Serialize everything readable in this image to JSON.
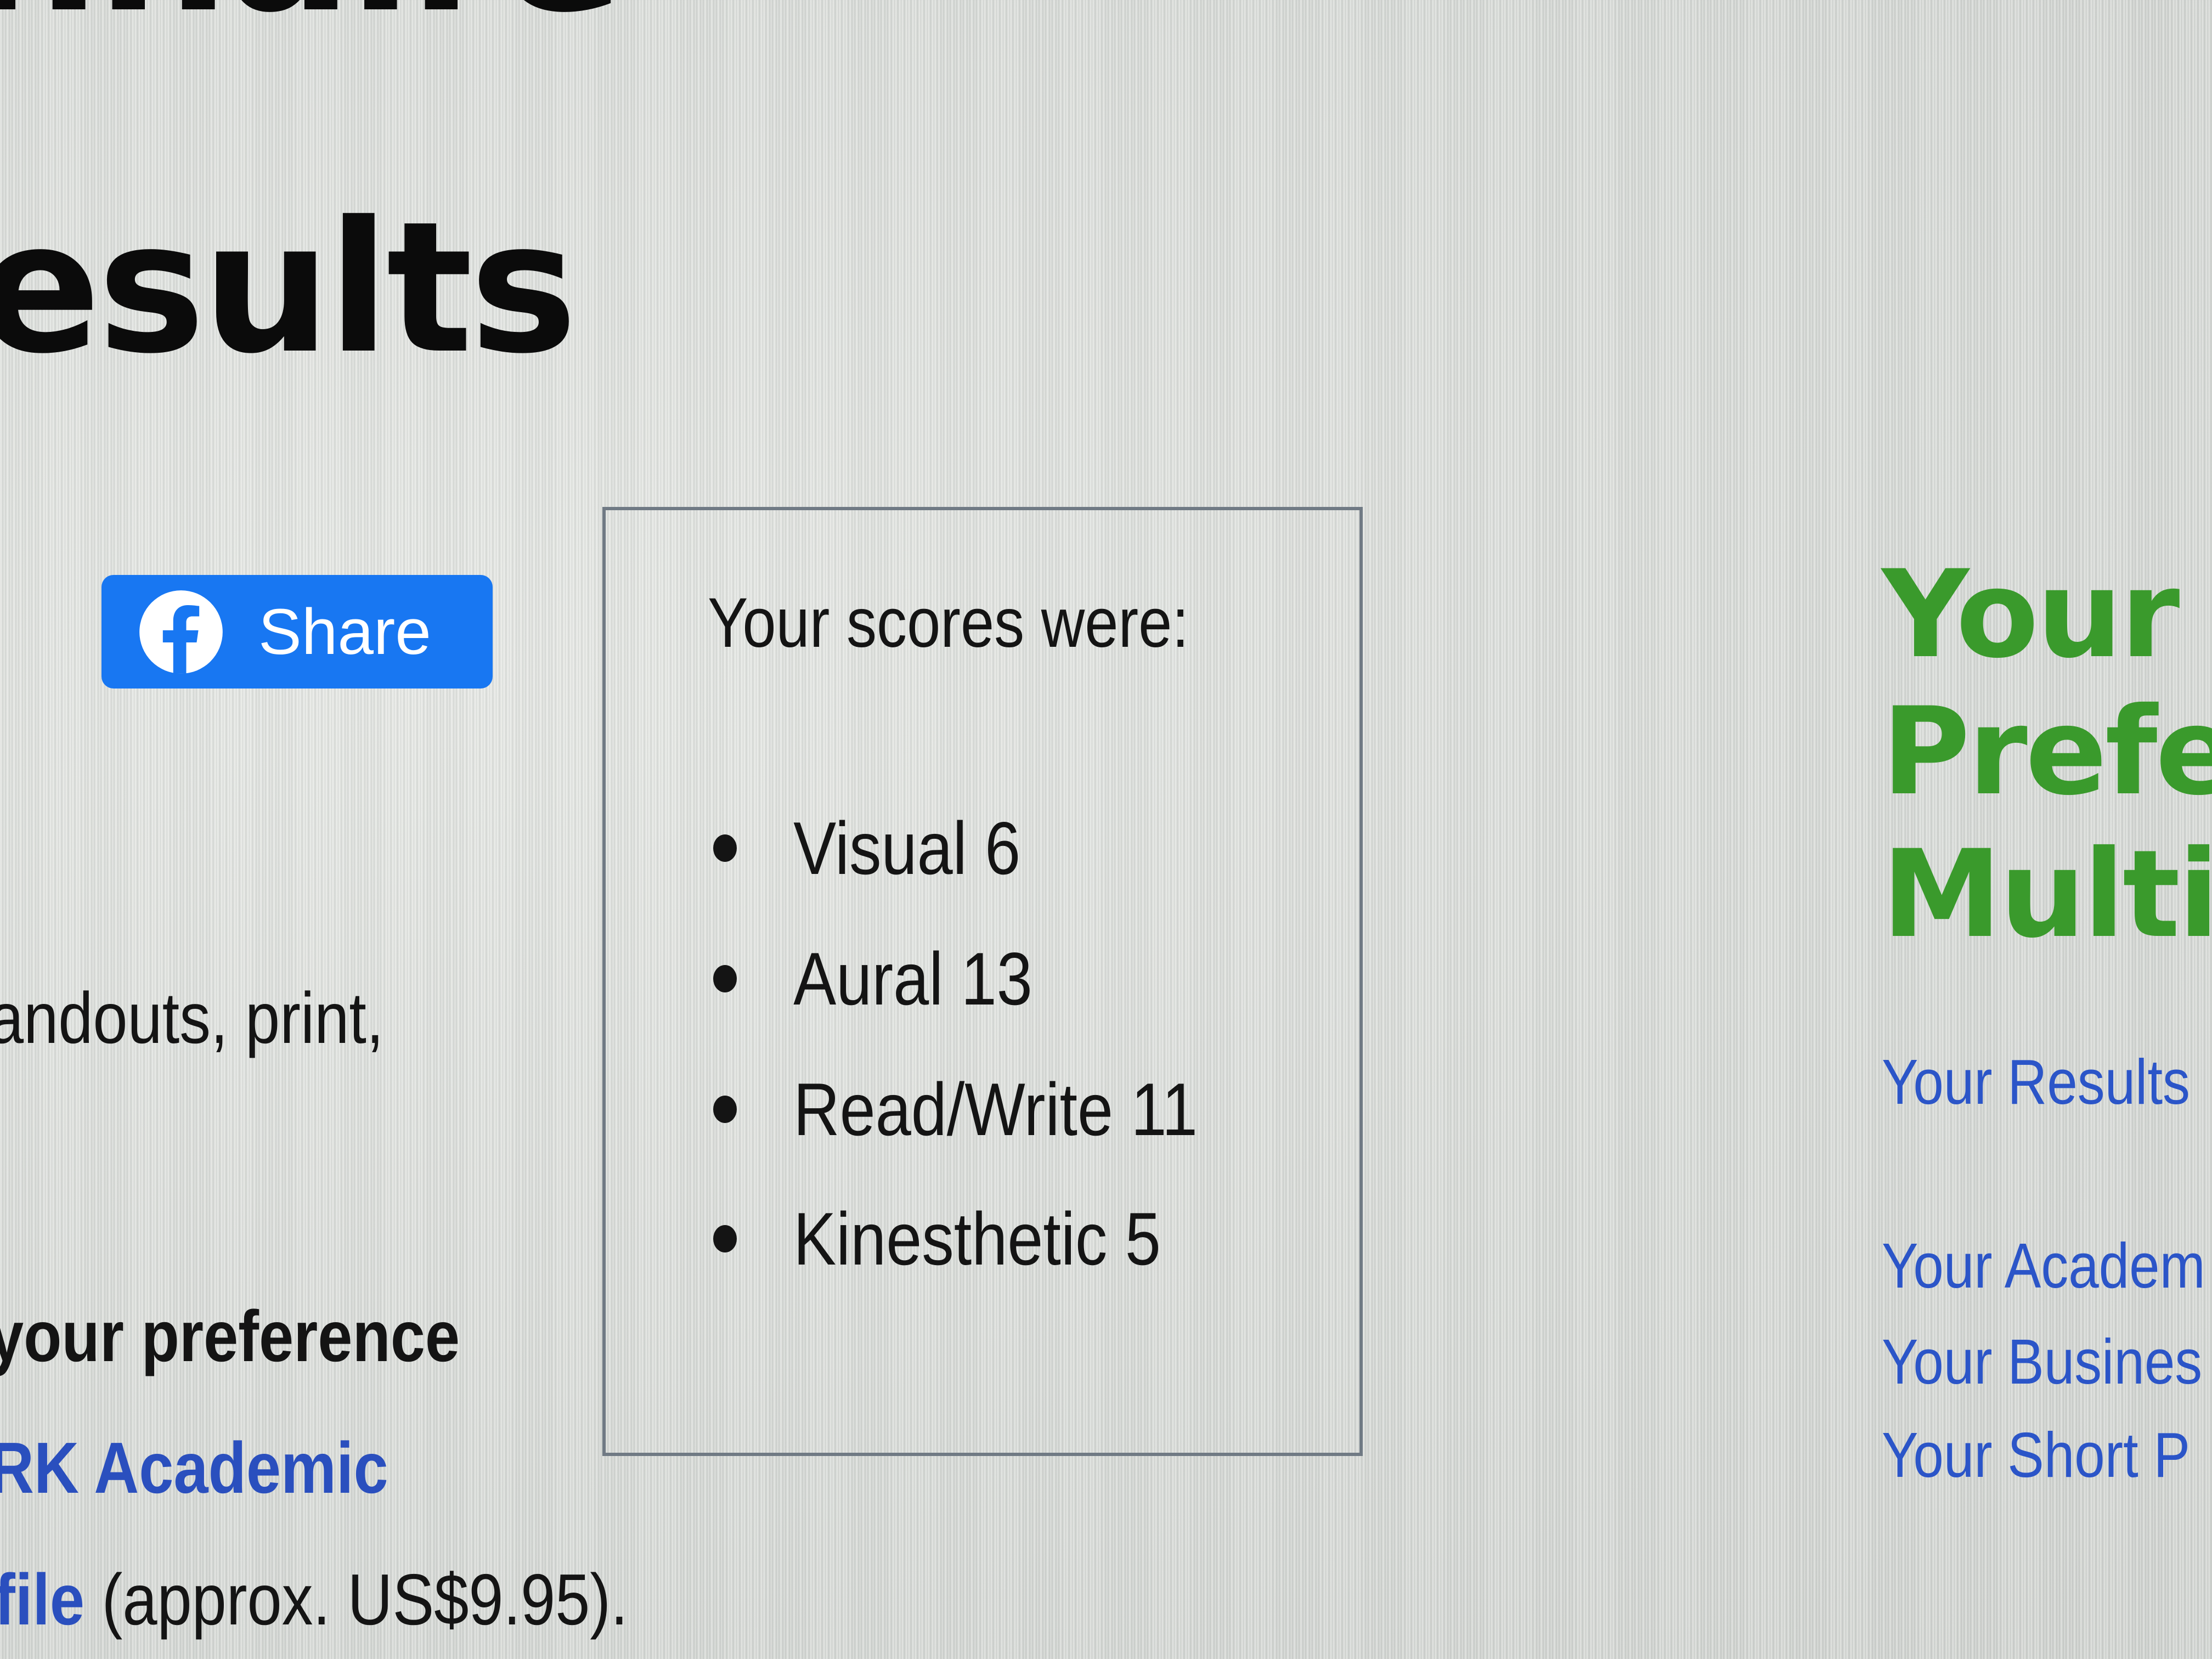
{
  "header": {
    "title_fragment": "nnaire",
    "subtitle_fragment": "esults"
  },
  "share_button": {
    "label": "Share"
  },
  "scores_box": {
    "title": "Your scores were:",
    "items": [
      {
        "label": "Visual 6"
      },
      {
        "label": "Aural 13"
      },
      {
        "label": "Read/Write 11"
      },
      {
        "label": "Kinesthetic 5"
      }
    ]
  },
  "body_text": {
    "line1": "andouts, print,",
    "line2": "your preference",
    "link1": "RK Academic",
    "link2": "file",
    "price_text": " (approx. US$9.95)."
  },
  "sidebar": {
    "heading_lines": [
      "Your",
      "Prefe",
      "Multi"
    ],
    "links": [
      "Your Results",
      "Your Academ",
      "Your Busines",
      "Your Short P"
    ]
  },
  "colors": {
    "facebook_blue": "#1877f2",
    "heading_green": "#3a9a2c",
    "link_blue": "#2b55c8"
  }
}
